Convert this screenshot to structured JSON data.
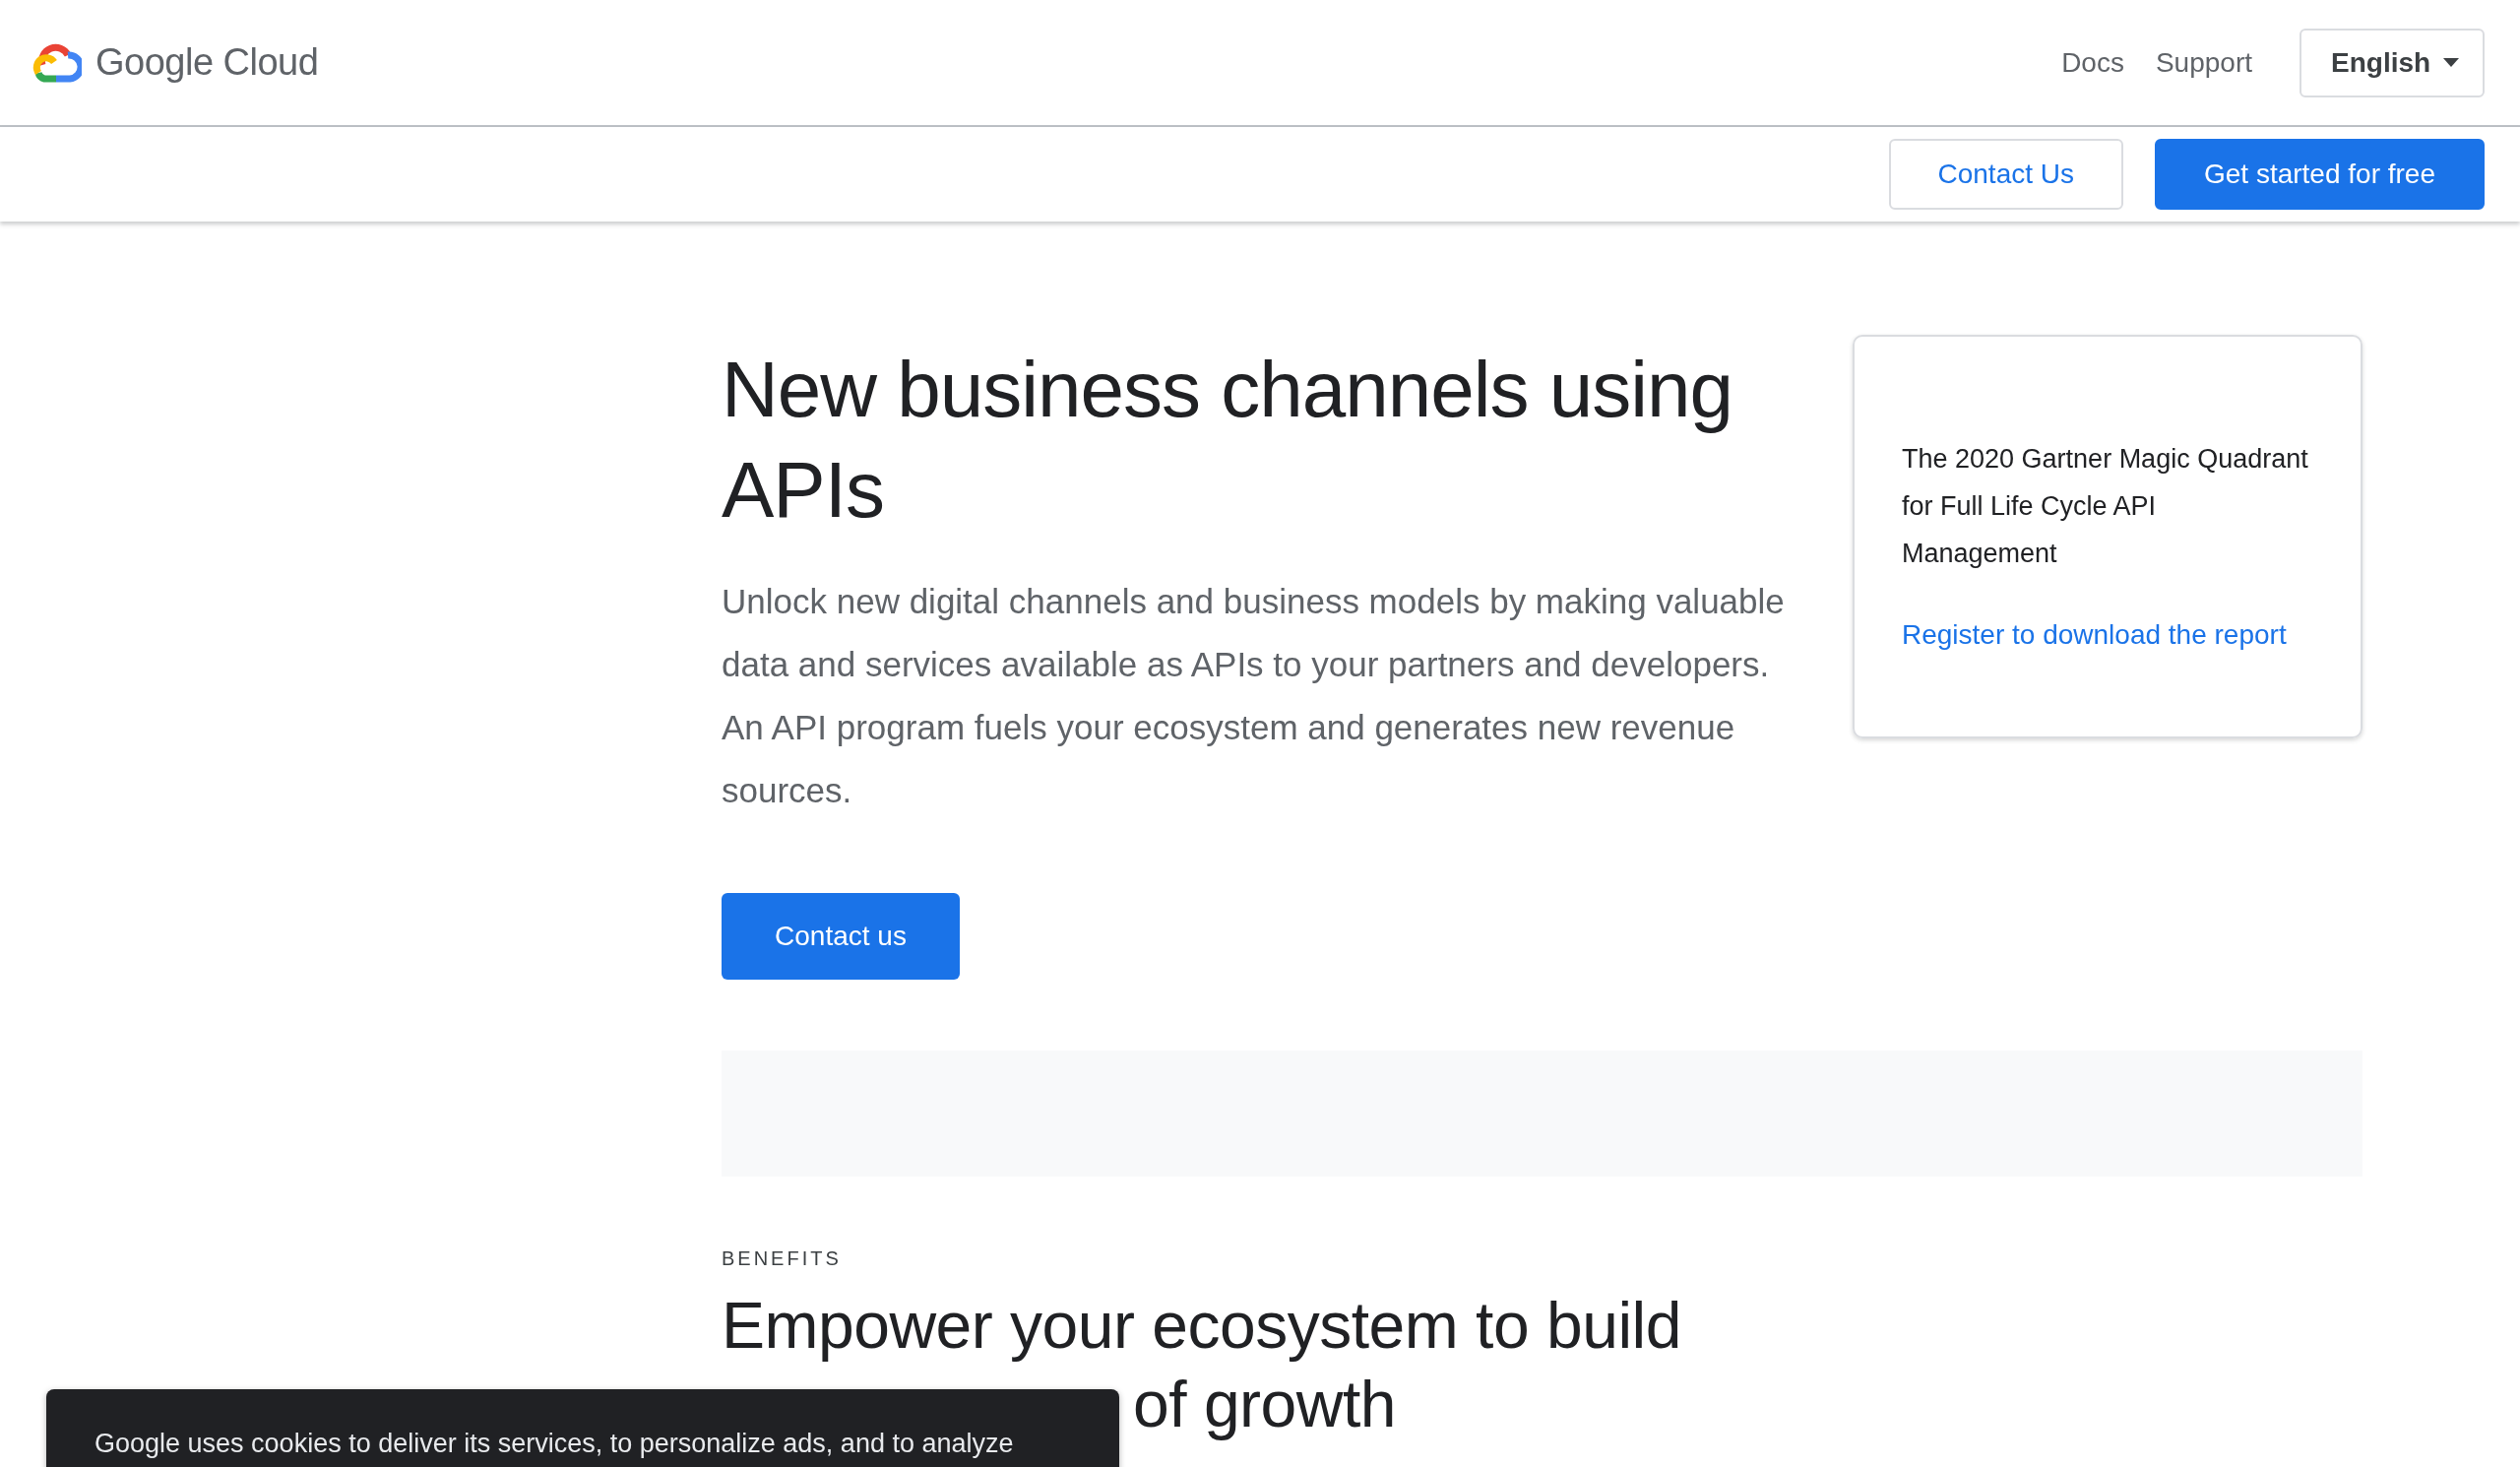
{
  "header": {
    "logo_text": "Google Cloud",
    "nav": [
      "Docs",
      "Support"
    ],
    "language": {
      "value": "English",
      "expanded": false
    }
  },
  "subbar": {
    "buttons": [
      {
        "label": "Contact Us",
        "kind": "outline"
      },
      {
        "label": "Get started for free",
        "kind": "filled"
      }
    ]
  },
  "hero": {
    "title": "New business channels using APIs",
    "description": "Unlock new digital channels and business models by making valuable data and services available as APIs to your partners and developers. An API program fuels your ecosystem and generates new revenue sources.",
    "button": "Contact us"
  },
  "report_card": {
    "text": "The 2020 Gartner Magic Quadrant for Full Life Cycle API Management",
    "link": "Register to download the report"
  },
  "benefits": {
    "eyebrow": "BENEFITS",
    "heading_line_1": "Empower your ecosystem to build",
    "heading_line_2_visible": "of growth"
  },
  "cookie_banner": {
    "text": "Google uses cookies to deliver its services, to personalize ads, and to analyze"
  }
}
